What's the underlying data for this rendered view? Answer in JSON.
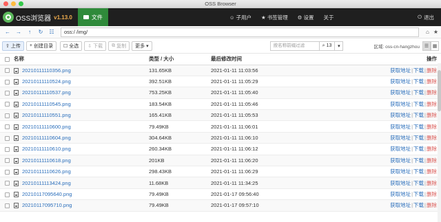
{
  "window": {
    "title": "OSS Browser"
  },
  "nav": {
    "brand": "OSS浏览器",
    "version": "v1.13.0",
    "file_tab": "文件",
    "items": [
      {
        "label": "子用户",
        "icon": "users-icon"
      },
      {
        "label": "书签管理",
        "icon": "bookmark-icon"
      },
      {
        "label": "设置",
        "icon": "gear-icon"
      },
      {
        "label": "关于",
        "icon": ""
      }
    ],
    "exit": "退出"
  },
  "address": {
    "value": "oss:/           /img/"
  },
  "toolbar": {
    "upload": "上传",
    "new_dir": "创建目录",
    "select_all": "全选",
    "download": "下载",
    "copy": "复制",
    "more": "更多",
    "search_placeholder": "按名称前缀过滤",
    "count": "13",
    "region": "区域: oss-cn-hangzhou"
  },
  "table": {
    "headers": {
      "name": "名称",
      "size": "类型 / 大小",
      "time": "最后修改时间",
      "ops": "操作"
    },
    "ops": {
      "get_url": "获取地址",
      "download": "下载",
      "delete": "删除",
      "sep": "|"
    },
    "rows": [
      {
        "name": "20210111110356.png",
        "size": "131.65KB",
        "time": "2021-01-11 11:03:56"
      },
      {
        "name": "20210111110524.png",
        "size": "392.51KB",
        "time": "2021-01-11 11:05:29"
      },
      {
        "name": "20210111110537.png",
        "size": "753.25KB",
        "time": "2021-01-11 11:05:40"
      },
      {
        "name": "20210111110545.png",
        "size": "183.54KB",
        "time": "2021-01-11 11:05:46"
      },
      {
        "name": "20210111110551.png",
        "size": "165.41KB",
        "time": "2021-01-11 11:05:53"
      },
      {
        "name": "20210111110600.png",
        "size": "79.49KB",
        "time": "2021-01-11 11:06:01"
      },
      {
        "name": "20210111110604.png",
        "size": "304.64KB",
        "time": "2021-01-11 11:06:10"
      },
      {
        "name": "20210111110610.png",
        "size": "260.34KB",
        "time": "2021-01-11 11:06:12"
      },
      {
        "name": "20210111110618.png",
        "size": "201KB",
        "time": "2021-01-11 11:06:20"
      },
      {
        "name": "20210111110626.png",
        "size": "298.43KB",
        "time": "2021-01-11 11:06:29"
      },
      {
        "name": "20210111113424.png",
        "size": "11.68KB",
        "time": "2021-01-11 11:34:25"
      },
      {
        "name": "20210117095640.png",
        "size": "79.49KB",
        "time": "2021-01-17 09:56:40"
      },
      {
        "name": "20210117095710.png",
        "size": "79.49KB",
        "time": "2021-01-17 09:57:10"
      }
    ]
  }
}
